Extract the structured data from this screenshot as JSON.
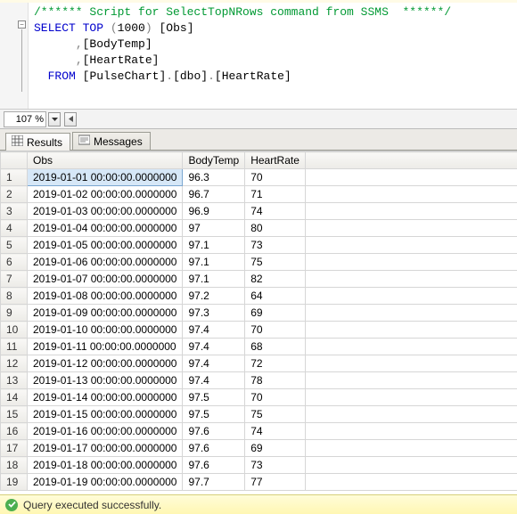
{
  "code": {
    "comment": "/****** Script for SelectTopNRows command from SSMS  ******/",
    "select_kw": "SELECT",
    "top_kw": "TOP",
    "top_paren_open": "(",
    "top_n": "1000",
    "top_paren_close": ")",
    "col1": "[Obs]",
    "comma": ",",
    "col2": "[BodyTemp]",
    "col3": "[HeartRate]",
    "from_kw": "FROM",
    "db": "[PulseChart]",
    "dot": ".",
    "schema": "[dbo]",
    "table": "[HeartRate]"
  },
  "zoom": {
    "value": "107 %"
  },
  "tabs": {
    "results": "Results",
    "messages": "Messages"
  },
  "grid": {
    "headers": {
      "obs": "Obs",
      "bodytemp": "BodyTemp",
      "heartrate": "HeartRate"
    },
    "rows": [
      {
        "n": "1",
        "obs": "2019-01-01 00:00:00.0000000",
        "bt": "96.3",
        "hr": "70"
      },
      {
        "n": "2",
        "obs": "2019-01-02 00:00:00.0000000",
        "bt": "96.7",
        "hr": "71"
      },
      {
        "n": "3",
        "obs": "2019-01-03 00:00:00.0000000",
        "bt": "96.9",
        "hr": "74"
      },
      {
        "n": "4",
        "obs": "2019-01-04 00:00:00.0000000",
        "bt": "97",
        "hr": "80"
      },
      {
        "n": "5",
        "obs": "2019-01-05 00:00:00.0000000",
        "bt": "97.1",
        "hr": "73"
      },
      {
        "n": "6",
        "obs": "2019-01-06 00:00:00.0000000",
        "bt": "97.1",
        "hr": "75"
      },
      {
        "n": "7",
        "obs": "2019-01-07 00:00:00.0000000",
        "bt": "97.1",
        "hr": "82"
      },
      {
        "n": "8",
        "obs": "2019-01-08 00:00:00.0000000",
        "bt": "97.2",
        "hr": "64"
      },
      {
        "n": "9",
        "obs": "2019-01-09 00:00:00.0000000",
        "bt": "97.3",
        "hr": "69"
      },
      {
        "n": "10",
        "obs": "2019-01-10 00:00:00.0000000",
        "bt": "97.4",
        "hr": "70"
      },
      {
        "n": "11",
        "obs": "2019-01-11 00:00:00.0000000",
        "bt": "97.4",
        "hr": "68"
      },
      {
        "n": "12",
        "obs": "2019-01-12 00:00:00.0000000",
        "bt": "97.4",
        "hr": "72"
      },
      {
        "n": "13",
        "obs": "2019-01-13 00:00:00.0000000",
        "bt": "97.4",
        "hr": "78"
      },
      {
        "n": "14",
        "obs": "2019-01-14 00:00:00.0000000",
        "bt": "97.5",
        "hr": "70"
      },
      {
        "n": "15",
        "obs": "2019-01-15 00:00:00.0000000",
        "bt": "97.5",
        "hr": "75"
      },
      {
        "n": "16",
        "obs": "2019-01-16 00:00:00.0000000",
        "bt": "97.6",
        "hr": "74"
      },
      {
        "n": "17",
        "obs": "2019-01-17 00:00:00.0000000",
        "bt": "97.6",
        "hr": "69"
      },
      {
        "n": "18",
        "obs": "2019-01-18 00:00:00.0000000",
        "bt": "97.6",
        "hr": "73"
      },
      {
        "n": "19",
        "obs": "2019-01-19 00:00:00.0000000",
        "bt": "97.7",
        "hr": "77"
      }
    ]
  },
  "status": {
    "text": "Query executed successfully."
  },
  "chart_data": {
    "type": "table",
    "title": "HeartRate query results",
    "columns": [
      "Obs",
      "BodyTemp",
      "HeartRate"
    ],
    "rows": [
      [
        "2019-01-01 00:00:00.0000000",
        96.3,
        70
      ],
      [
        "2019-01-02 00:00:00.0000000",
        96.7,
        71
      ],
      [
        "2019-01-03 00:00:00.0000000",
        96.9,
        74
      ],
      [
        "2019-01-04 00:00:00.0000000",
        97,
        80
      ],
      [
        "2019-01-05 00:00:00.0000000",
        97.1,
        73
      ],
      [
        "2019-01-06 00:00:00.0000000",
        97.1,
        75
      ],
      [
        "2019-01-07 00:00:00.0000000",
        97.1,
        82
      ],
      [
        "2019-01-08 00:00:00.0000000",
        97.2,
        64
      ],
      [
        "2019-01-09 00:00:00.0000000",
        97.3,
        69
      ],
      [
        "2019-01-10 00:00:00.0000000",
        97.4,
        70
      ],
      [
        "2019-01-11 00:00:00.0000000",
        97.4,
        68
      ],
      [
        "2019-01-12 00:00:00.0000000",
        97.4,
        72
      ],
      [
        "2019-01-13 00:00:00.0000000",
        97.4,
        78
      ],
      [
        "2019-01-14 00:00:00.0000000",
        97.5,
        70
      ],
      [
        "2019-01-15 00:00:00.0000000",
        97.5,
        75
      ],
      [
        "2019-01-16 00:00:00.0000000",
        97.6,
        74
      ],
      [
        "2019-01-17 00:00:00.0000000",
        97.6,
        69
      ],
      [
        "2019-01-18 00:00:00.0000000",
        97.6,
        73
      ],
      [
        "2019-01-19 00:00:00.0000000",
        97.7,
        77
      ]
    ]
  }
}
